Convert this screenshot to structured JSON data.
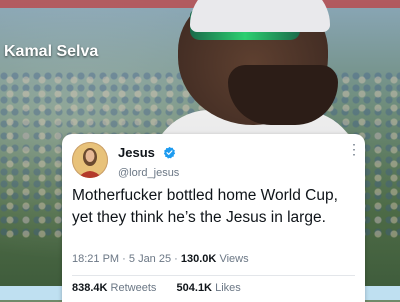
{
  "overlay": {
    "name_label": "Kamal Selva"
  },
  "tweet": {
    "display_name": "Jesus",
    "username": "@lord_jesus",
    "text": "Motherfucker bottled home World Cup, yet they think he’s the Jesus in large.",
    "time": "18:21 PM",
    "date": "5 Jan 25",
    "views_count": "130.0K",
    "views_label": "Views",
    "retweets_count": "838.4K",
    "retweets_label": "Retweets",
    "likes_count": "504.1K",
    "likes_label": "Likes",
    "verified_color": "#1d9bf0",
    "icons": [
      "verified-badge-icon",
      "more-options-icon"
    ]
  },
  "colors": {
    "card_background": "#ffffff",
    "primary_text": "#0f1419",
    "secondary_text": "#6b7785",
    "name_label": "#ffffff"
  }
}
